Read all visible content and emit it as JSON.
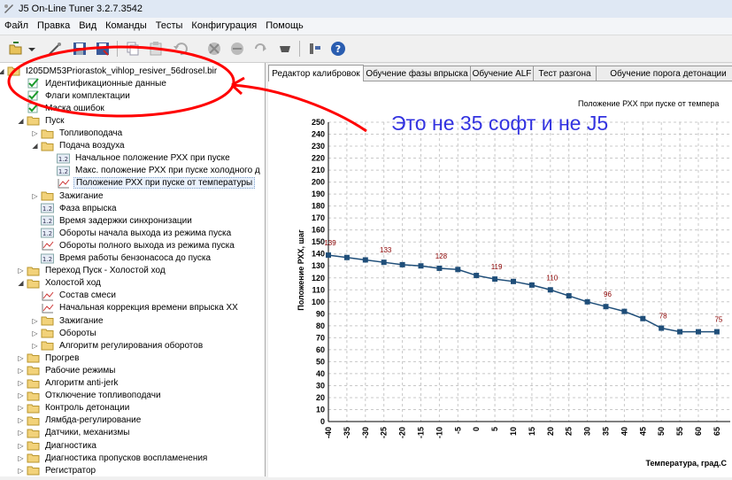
{
  "window": {
    "title": "J5 On-Line Tuner 3.2.7.3542"
  },
  "menu": [
    "Файл",
    "Правка",
    "Вид",
    "Команды",
    "Тесты",
    "Конфигурация",
    "Помощь"
  ],
  "toolbar": {
    "buttons": [
      "open-icon",
      "dropdown-icon",
      "wand-icon",
      "save-icon",
      "save-as-icon",
      "copy-icon",
      "paste-icon",
      "undo-icon",
      "connect-icon",
      "disconnect-icon",
      "refresh-icon",
      "chip-icon",
      "settings-icon",
      "help-icon"
    ]
  },
  "tree": {
    "items": [
      {
        "label": "I205DM53Priorastok_vihlop_resiver_56drosel.bir",
        "level": 0,
        "icon": "folder",
        "expander": "open"
      },
      {
        "label": "Идентификационные данные",
        "level": 1,
        "icon": "check",
        "expander": ""
      },
      {
        "label": "Флаги комплектации",
        "level": 1,
        "icon": "check",
        "expander": ""
      },
      {
        "label": "Маска ошибок",
        "level": 1,
        "icon": "check",
        "expander": ""
      },
      {
        "label": "Пуск",
        "level": 1,
        "icon": "folder",
        "expander": "open"
      },
      {
        "label": "Топливоподача",
        "level": 2,
        "icon": "folder",
        "expander": "closed"
      },
      {
        "label": "Подача воздуха",
        "level": 2,
        "icon": "folder",
        "expander": "open"
      },
      {
        "label": "Начальное положение РХХ при пуске",
        "level": 3,
        "icon": "value",
        "expander": ""
      },
      {
        "label": "Макс. положение РХХ при пуске холодного д",
        "level": 3,
        "icon": "value",
        "expander": ""
      },
      {
        "label": "Положение РХХ при пуске от температуры",
        "level": 3,
        "icon": "graph",
        "expander": "",
        "selected": true
      },
      {
        "label": "Зажигание",
        "level": 2,
        "icon": "folder",
        "expander": "closed"
      },
      {
        "label": "Фаза впрыска",
        "level": 2,
        "icon": "value",
        "expander": ""
      },
      {
        "label": "Время задержки синхронизации",
        "level": 2,
        "icon": "value",
        "expander": ""
      },
      {
        "label": "Обороты начала выхода из режима пуска",
        "level": 2,
        "icon": "value",
        "expander": ""
      },
      {
        "label": "Обороты полного выхода из режима пуска",
        "level": 2,
        "icon": "graph",
        "expander": ""
      },
      {
        "label": "Время работы бензонасоса до пуска",
        "level": 2,
        "icon": "value",
        "expander": ""
      },
      {
        "label": "Переход Пуск - Холостой ход",
        "level": 1,
        "icon": "folder",
        "expander": "closed"
      },
      {
        "label": "Холостой ход",
        "level": 1,
        "icon": "folder",
        "expander": "open"
      },
      {
        "label": "Состав смеси",
        "level": 2,
        "icon": "graph",
        "expander": ""
      },
      {
        "label": "Начальная коррекция времени впрыска ХХ",
        "level": 2,
        "icon": "graph",
        "expander": ""
      },
      {
        "label": "Зажигание",
        "level": 2,
        "icon": "folder",
        "expander": "closed"
      },
      {
        "label": "Обороты",
        "level": 2,
        "icon": "folder",
        "expander": "closed"
      },
      {
        "label": "Алгоритм регулирования оборотов",
        "level": 2,
        "icon": "folder",
        "expander": "closed"
      },
      {
        "label": "Прогрев",
        "level": 1,
        "icon": "folder",
        "expander": "closed"
      },
      {
        "label": "Рабочие режимы",
        "level": 1,
        "icon": "folder",
        "expander": "closed"
      },
      {
        "label": "Алгоритм anti-jerk",
        "level": 1,
        "icon": "folder",
        "expander": "closed"
      },
      {
        "label": "Отключение топливоподачи",
        "level": 1,
        "icon": "folder",
        "expander": "closed"
      },
      {
        "label": "Контроль детонации",
        "level": 1,
        "icon": "folder",
        "expander": "closed"
      },
      {
        "label": "Лямбда-регулирование",
        "level": 1,
        "icon": "folder",
        "expander": "closed"
      },
      {
        "label": "Датчики, механизмы",
        "level": 1,
        "icon": "folder",
        "expander": "closed"
      },
      {
        "label": "Диагностика",
        "level": 1,
        "icon": "folder",
        "expander": "closed"
      },
      {
        "label": "Диагностика пропусков воспламенения",
        "level": 1,
        "icon": "folder",
        "expander": "closed"
      },
      {
        "label": "Регистратор",
        "level": 1,
        "icon": "folder",
        "expander": "closed"
      }
    ]
  },
  "tabs": [
    {
      "label": "Редактор калибровок",
      "active": true
    },
    {
      "label": "Обучение фазы впрыска",
      "active": false
    },
    {
      "label": "Обучение ALF",
      "active": false
    },
    {
      "label": "Тест разгона",
      "active": false
    },
    {
      "label": "Обучение порога детонации",
      "active": false
    }
  ],
  "annotation": {
    "text": "Это не 35 софт и не J5",
    "color": "#3333e0",
    "outline_color": "#ff0000"
  },
  "chart_data": {
    "type": "line",
    "title": "Положение РХХ при пуске от темпера",
    "xlabel": "Температура, град.С",
    "ylabel": "Положение РХХ, шаг",
    "x": [
      -40,
      -35,
      -30,
      -25,
      -20,
      -15,
      -10,
      -5,
      0,
      5,
      10,
      15,
      20,
      25,
      30,
      35,
      40,
      45,
      50,
      55,
      60,
      65
    ],
    "values": [
      139,
      137,
      135,
      133,
      131,
      130,
      128,
      127,
      122,
      119,
      117,
      114,
      110,
      105,
      100,
      96,
      92,
      86,
      78,
      75,
      75,
      75
    ],
    "point_labels": {
      "-40": "139",
      "-25": "133",
      "-10": "128",
      "5": "119",
      "20": "110",
      "35": "96",
      "50": "78",
      "65": "75"
    },
    "xticks": [
      -40,
      -35,
      -30,
      -25,
      -20,
      -15,
      -10,
      -5,
      0,
      5,
      10,
      15,
      20,
      25,
      30,
      35,
      40,
      45,
      50,
      55,
      60,
      65
    ],
    "yticks": [
      0,
      10,
      20,
      30,
      40,
      50,
      60,
      70,
      80,
      90,
      100,
      110,
      120,
      130,
      140,
      150,
      160,
      170,
      180,
      190,
      200,
      210,
      220,
      230,
      240,
      250
    ],
    "ylim": [
      0,
      250
    ],
    "grid": true,
    "line_color": "#1f4e79",
    "label_color": "#8b0000"
  }
}
